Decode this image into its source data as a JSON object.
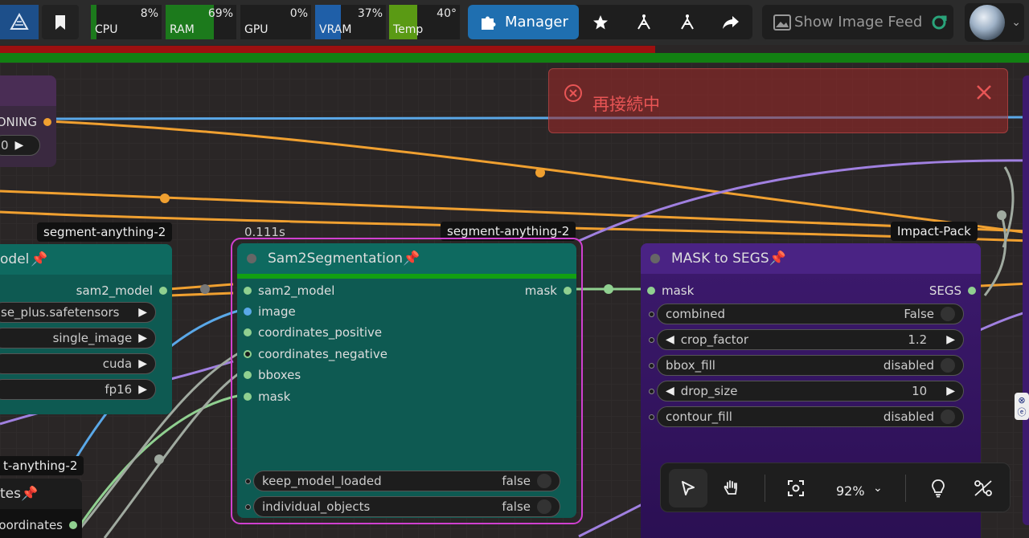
{
  "topbar": {
    "meters": [
      {
        "label": "CPU",
        "value": "8%",
        "fill": 0.08,
        "color": "#1c7a1c"
      },
      {
        "label": "RAM",
        "value": "69%",
        "fill": 0.69,
        "color": "#1c7a1c"
      },
      {
        "label": "GPU",
        "value": "0%",
        "fill": 0.0,
        "color": "#1c7a1c"
      },
      {
        "label": "VRAM",
        "value": "37%",
        "fill": 0.37,
        "color": "#1f5fa8"
      },
      {
        "label": "Temp",
        "value": "40°",
        "fill": 0.4,
        "color": "#5a9a14"
      }
    ],
    "manager_label": "Manager",
    "feed_label": "Show Image Feed"
  },
  "toast": {
    "message": "再接続中"
  },
  "nodes": {
    "left_top": {
      "output_label": "ONING",
      "widget_value": "0"
    },
    "model_loader": {
      "badge": "segment-anything-2",
      "title": "odel",
      "output": "sam2_model",
      "widgets": [
        "se_plus.safetensors",
        "single_image",
        "cuda",
        "fp16"
      ]
    },
    "sam2seg": {
      "timing": "0.111s",
      "badge": "segment-anything-2",
      "title": "Sam2Segmentation",
      "inputs": [
        "sam2_model",
        "image",
        "coordinates_positive",
        "coordinates_negative",
        "bboxes",
        "mask"
      ],
      "output": "mask",
      "widgets": [
        {
          "name": "keep_model_loaded",
          "value": "false"
        },
        {
          "name": "individual_objects",
          "value": "false"
        }
      ]
    },
    "mask_to_segs": {
      "badge": "Impact-Pack",
      "title": "MASK to SEGS",
      "input": "mask",
      "output": "SEGS",
      "widgets": [
        {
          "name": "combined",
          "value": "False",
          "kind": "toggle"
        },
        {
          "name": "crop_factor",
          "value": "1.2",
          "kind": "number"
        },
        {
          "name": "bbox_fill",
          "value": "disabled",
          "kind": "toggle"
        },
        {
          "name": "drop_size",
          "value": "10",
          "kind": "number"
        },
        {
          "name": "contour_fill",
          "value": "disabled",
          "kind": "toggle"
        }
      ]
    },
    "bottom_left": {
      "badge": "t-anything-2",
      "title": "tes",
      "output": "oordinates"
    }
  },
  "canvas_tools": {
    "zoom": "92%"
  },
  "colors": {
    "node_teal": "#0e5a52",
    "node_purple": "#3d1a6e",
    "selection": "#d040d0",
    "wire_orange": "#f0a030",
    "wire_blue": "#5aa8e8",
    "wire_purple": "#a080e0",
    "wire_green": "#90d090"
  }
}
